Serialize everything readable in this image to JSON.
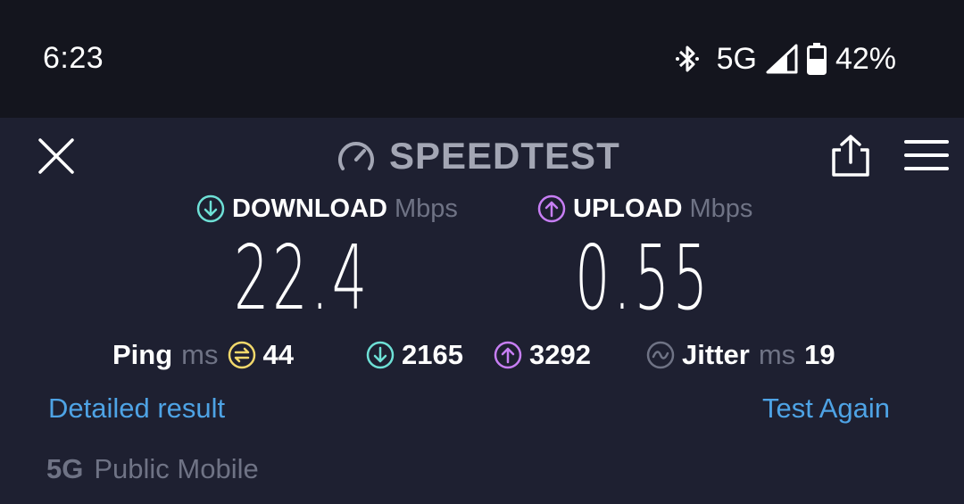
{
  "status_bar": {
    "time": "6:23",
    "network": "5G",
    "battery": "42%",
    "icons": [
      "bluetooth-icon",
      "signal-icon",
      "battery-icon"
    ]
  },
  "header": {
    "brand": "SPEEDTEST",
    "icons": [
      "close-icon",
      "speedometer-icon",
      "share-icon",
      "menu-icon"
    ]
  },
  "download": {
    "label": "DOWNLOAD",
    "unit": "Mbps",
    "value": "22.4"
  },
  "upload": {
    "label": "UPLOAD",
    "unit": "Mbps",
    "value": "0.55"
  },
  "stats": {
    "ping_label": "Ping",
    "ping_unit": "ms",
    "ping_value": "44",
    "download_latency": "2165",
    "upload_latency": "3292",
    "jitter_label": "Jitter",
    "jitter_unit": "ms",
    "jitter_value": "19"
  },
  "actions": {
    "detailed": "Detailed result",
    "again": "Test Again"
  },
  "carrier": {
    "network": "5G",
    "name": "Public Mobile"
  },
  "colors": {
    "download": "#6ee0d6",
    "upload": "#c77ef4",
    "ping": "#f2d86b",
    "link": "#4ea3e5",
    "muted": "#6f7385",
    "background": "#1e2031",
    "statusbar": "#14151e"
  }
}
